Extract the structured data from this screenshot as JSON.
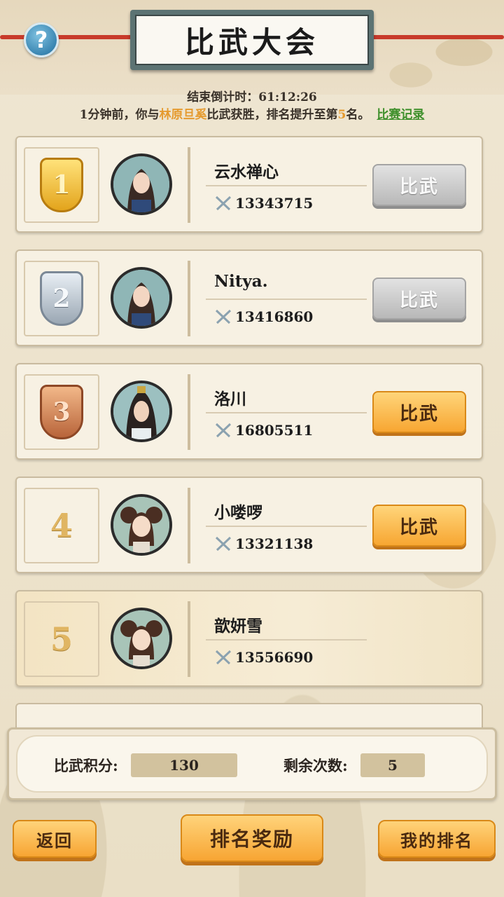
{
  "header": {
    "title": "比武大会",
    "help_icon": "?",
    "countdown_label": "结束倒计时：",
    "countdown_value": "61:12:26"
  },
  "notice": {
    "prefix": "1分钟前，你与",
    "opponent": "林原旦奚",
    "middle": "比武获胜，排名提升至第",
    "rank": "5",
    "suffix": "名。",
    "link": "比赛记录"
  },
  "players": [
    {
      "rank": "1",
      "name": "云水禅心",
      "power": "13343715",
      "button": "比武",
      "button_state": "gray"
    },
    {
      "rank": "2",
      "name": "Nitya.",
      "power": "13416860",
      "button": "比武",
      "button_state": "gray"
    },
    {
      "rank": "3",
      "name": "洛川",
      "power": "16805511",
      "button": "比武",
      "button_state": "orange"
    },
    {
      "rank": "4",
      "name": "小喽啰",
      "power": "13321138",
      "button": "比武",
      "button_state": "orange"
    },
    {
      "rank": "5",
      "name": "歆妍雪",
      "power": "13556690",
      "button": "",
      "button_state": "none"
    }
  ],
  "stats": {
    "points_label": "比武积分:",
    "points_value": "130",
    "remaining_label": "剩余次数:",
    "remaining_value": "5"
  },
  "buttons": {
    "back": "返回",
    "rank_rewards": "排名奖励",
    "my_rank": "我的排名"
  },
  "colors": {
    "accent_orange": "#f7a632",
    "highlight_name": "#e59a2e",
    "link_green": "#3d8f2a",
    "rope_red": "#c83a2a"
  }
}
